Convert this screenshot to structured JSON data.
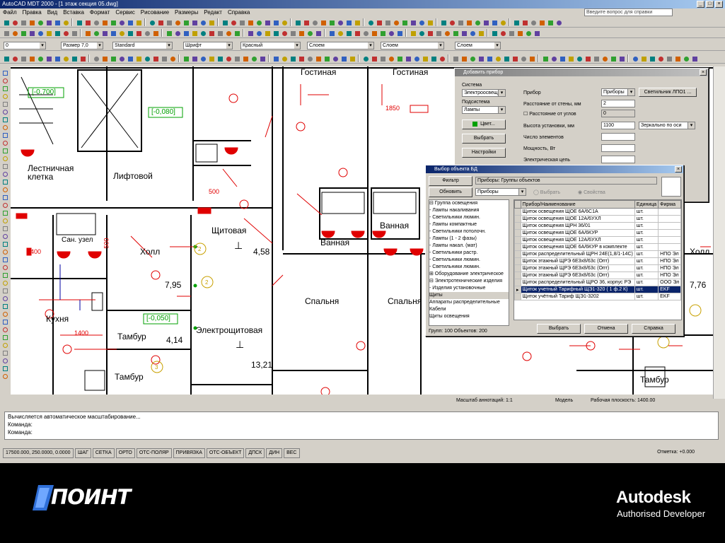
{
  "window": {
    "title": "AutoCAD MDT 2000 - [1 этаж секция 05.dwg]",
    "help_placeholder": "Введите вопрос для справки"
  },
  "menu": [
    "Файл",
    "Правка",
    "Вид",
    "Вставка",
    "Формат",
    "Сервис",
    "Рисование",
    "Размеры",
    "Редакт",
    "Справка"
  ],
  "toolbar_combos": {
    "layer": "0",
    "linetype_a": "Размер 7,0",
    "style": "Standard",
    "text": "Шрифт",
    "color": "Красный",
    "linetype": "Слоем",
    "lineweight": "Слоем",
    "plotstyle": "Слоем"
  },
  "rooms": {
    "gostinaya1": "Гостиная",
    "gostinaya2": "Гостиная",
    "lestnichnaya": "Лестничная клетка",
    "lift": "Лифтовой",
    "shitovaya": "Щитовая",
    "holl": "Холл",
    "kuhnya": "Кухня",
    "san_uzel": "Сан. узел",
    "vannaya": "Ванная",
    "vannaya2": "Ванная",
    "spalnya": "Спальня",
    "spalnya2": "Спальня",
    "tambur1": "Тамбур",
    "tambur2": "Тамбур",
    "tambur3": "Тамбур",
    "electroshitovaya": "Электрощитовая",
    "holl2": "Холл",
    "elev1": "[-0,700]",
    "elev2": "[-0,080]",
    "elev3": "[-0,050]",
    "area1": "4,58",
    "area2": "7,95",
    "area3": "4,14",
    "area4": "13,21",
    "area5": "7,76",
    "dim1": "1850",
    "dim2": "1400",
    "dim3": "1400",
    "dim4": "500",
    "dim5": "500"
  },
  "status_row": {
    "left": "Масштаб аннотаций: 1:1",
    "model": "Модель",
    "right": "Рабочая плоскость: 1400.00"
  },
  "command": {
    "line1": "Вычисляется автоматическое масштабирование...",
    "line2": "Команда:",
    "line3": "Команда:"
  },
  "bottom_status": {
    "coords": "17500.000, 250.0000, 0.0000",
    "toggles": [
      "ШАГ",
      "СЕТКА",
      "ОРТО",
      "ОТС-ПОЛЯР",
      "ПРИВЯЗКА",
      "ОТС-ОБЪЕКТ",
      "ДПСК",
      "ДИН",
      "ВЕС"
    ],
    "right": "Отметка: +0.000"
  },
  "dialog_add": {
    "title": "Добавить прибор",
    "system_label": "Система",
    "system_value": "Электроосвещ.",
    "subsystem_label": "Подсистема",
    "subsystem_value": "Лампы",
    "color_btn": "Цвет...",
    "select_btn": "Выбрать",
    "settings_btn": "Настройки",
    "device_label": "Прибор",
    "device_value": "Приборы",
    "device_btn": "Светильник ЛПО1",
    "dist_axis_label": "Расстояние от стены, мм",
    "dist_axis_value": "2",
    "dist_rel_label": "Расстояние от углов",
    "dist_rel_value": "0",
    "height_label": "Высота установки, мм",
    "height_value": "1100",
    "height_combo": "Зеркально по оси",
    "count_label": "Число элементов",
    "power_label": "Мощность, Вт",
    "phase_label": "Фазировка",
    "electric_label": "Электрическая цепь"
  },
  "dialog_db": {
    "title": "Выбор объекта БД",
    "filter_btn": "Фильтр",
    "path_label": "Приборы: Группы объектов",
    "refresh_btn": "Обновить",
    "refresh_combo": "Приборы",
    "radio1": "Выбрать",
    "radio2": "Свойства",
    "tree": [
      "⊟ Группа освещения",
      "   - Лампы накаливания",
      "   - Светильники люмин.",
      "   - Лампы компактные",
      "   - Светильники потолочн.",
      "   - Лампы (1 - 2 фазы)",
      "   - Лампы накал. (мат)",
      "   - Светильники растр.",
      "   - Светильники люмин.",
      "   - Светильники люмин.",
      "⊞ Оборудование электрическое",
      "⊟ Электротехнические изделия",
      "   - Изделия установочные",
      "   Щиты",
      "   Аппараты распределительные",
      "   Кабели",
      "   Щиты освещения"
    ],
    "tree_footer": "Групп: 100   Объектов: 200",
    "columns": [
      "Прибор/Наименование",
      "Единица",
      "Фирма"
    ],
    "rows": [
      {
        "name": "Щиток освещения ЩОЕ 6А/6С1А",
        "unit": "шт.",
        "firm": ""
      },
      {
        "name": "Щиток освещения ЩОЕ 12А/6УХЛ",
        "unit": "шт.",
        "firm": ""
      },
      {
        "name": "Щиток освещения ЩРН 36/01",
        "unit": "шт.",
        "firm": ""
      },
      {
        "name": "Щиток освещения ЩОЕ 6А/6КУР",
        "unit": "шт.",
        "firm": ""
      },
      {
        "name": "Щиток освещения ЩОЕ 12А/6УХЛ",
        "unit": "шт.",
        "firm": ""
      },
      {
        "name": "Щиток освещения ЩОЕ 6А/6КУР в комплекте",
        "unit": "шт.",
        "firm": ""
      },
      {
        "name": "Щиток распределительный ЩРН 24Е(1,8/1-14С)",
        "unit": "шт.",
        "firm": "НПО Эл"
      },
      {
        "name": "Щиток этажный ЩРЭ 6Е3х8/63с (Опт)",
        "unit": "шт.",
        "firm": "НПО Эл"
      },
      {
        "name": "Щиток этажный ЩРЭ 6Е3х8/63с (Опт)",
        "unit": "шт.",
        "firm": "НПО Эл"
      },
      {
        "name": "Щиток этажный ЩРЭ 6Е3х8/63с (Опт)",
        "unit": "шт.",
        "firm": "НПО Эл"
      },
      {
        "name": "Щиток распределительный ЩРО 36, корпус РЭ",
        "unit": "шт.",
        "firm": "ООО Эл"
      },
      {
        "name": "Щиток учетный Тарифный ЩЭ1-320 ( 1 ф.2 К)",
        "unit": "шт.",
        "firm": "EKF"
      },
      {
        "name": "Щиток учётный Тариф ЩЭ1-3202",
        "unit": "шт.",
        "firm": "EKF"
      }
    ],
    "selected_row": 11,
    "btn_select": "Выбрать",
    "btn_cancel": "Отмена",
    "btn_help": "Справка"
  },
  "branding": {
    "poynt": "ПОИНТ",
    "autodesk": "Autodesk",
    "autodesk_sub": "Authorised Developer"
  },
  "colors": {
    "title_active": "#0a246a",
    "drawing_bg": "#ffffff",
    "plan_red": "#e00000",
    "plan_green": "#00a000",
    "plan_blue": "#0000a0"
  }
}
